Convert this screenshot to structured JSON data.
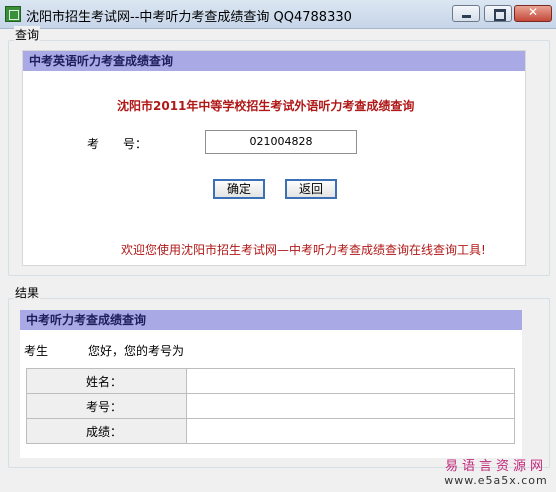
{
  "window": {
    "title": "沈阳市招生考试网--中考听力考查成绩查询 QQ4788330",
    "close_glyph": "✕"
  },
  "query_group": {
    "label": "查询",
    "panel_title": "中考英语听力考查成绩查询",
    "heading": "沈阳市2011年中等学校招生考试外语听力考查成绩查询",
    "exam_no_label": "考　　号：",
    "exam_no_value": "021004828",
    "confirm_label": "确定",
    "back_label": "返回",
    "welcome": "欢迎您使用沈阳市招生考试网—中考听力考查成绩查询在线查询工具!"
  },
  "result_group": {
    "label": "结果",
    "panel_title": "中考听力考查成绩查询",
    "greeting_prefix": "考生",
    "greeting_text": "您好，您的考号为",
    "rows": [
      {
        "key": "姓名：",
        "value": ""
      },
      {
        "key": "考号：",
        "value": ""
      },
      {
        "key": "成绩：",
        "value": ""
      }
    ]
  },
  "watermark": {
    "line1": "易语言资源网",
    "line2": "www.e5a5x.com"
  }
}
